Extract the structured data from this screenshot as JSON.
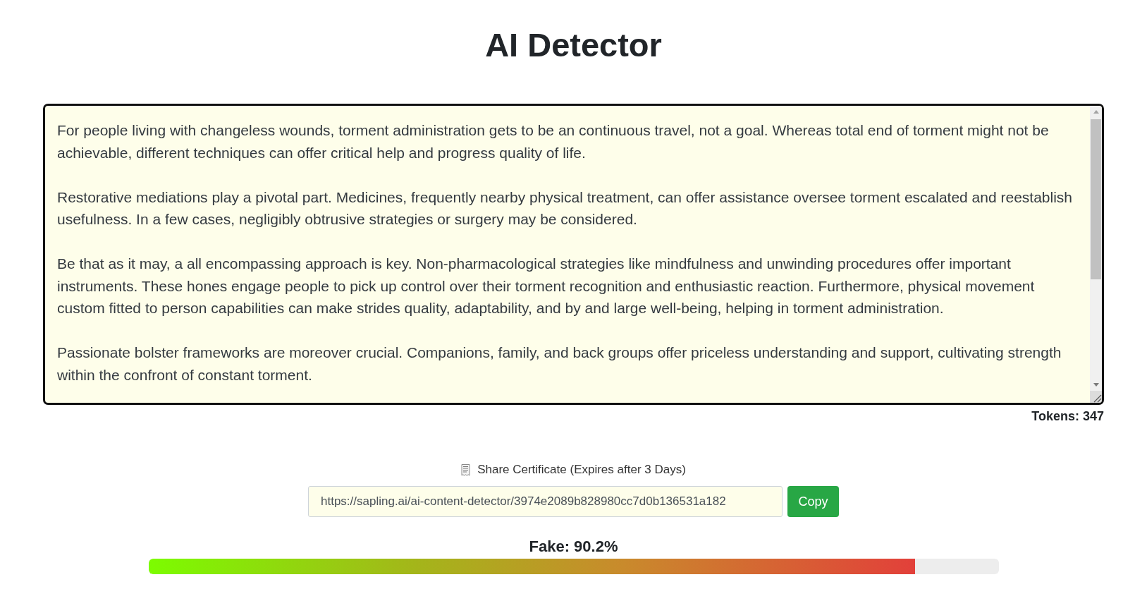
{
  "title": "AI Detector",
  "editor": {
    "paragraphs": [
      [
        "For people living with changeless wounds, torment administration gets to be an continuous travel, not a goal. Whereas total end of torment might not be",
        "achievable, different techniques can offer critical help and progress quality of life."
      ],
      [
        "Restorative mediations play a pivotal part. Medicines, frequently nearby physical treatment, can offer assistance oversee torment escalated and reestablish",
        "usefulness. In a few cases, negligibly obtrusive strategies or surgery may be considered."
      ],
      [
        "Be that as it may, a all encompassing approach is key. Non-pharmacological strategies like mindfulness and unwinding procedures offer important",
        "instruments. These hones engage people to pick up control over their torment recognition and enthusiastic reaction. Furthermore, physical movement",
        "custom fitted to person capabilities can make strides quality, adaptability, and by and large well-being, helping in torment administration."
      ],
      [
        "Passionate bolster frameworks are moreover crucial. Companions, family, and back groups offer priceless understanding and support, cultivating strength",
        "within the confront of constant torment."
      ]
    ],
    "tokens": "Tokens: 347"
  },
  "share": {
    "label": "Share Certificate (Expires after 3 Days)",
    "url": "https://sapling.ai/ai-content-detector/3974e2089b828980cc7d0b136531a182",
    "button": "Copy"
  },
  "result": {
    "label": "Fake: 90.2%",
    "level": 0.902
  }
}
